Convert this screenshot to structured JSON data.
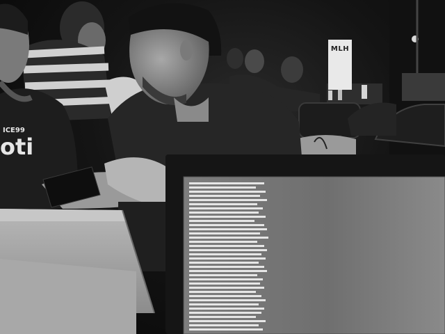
{
  "scene": {
    "description_free": true,
    "background_color": "#0d0d0d",
    "accent_light": "#f2f2f2"
  },
  "banner": {
    "text": "MLH"
  },
  "left_person": {
    "shirt_logo_small": "ICE99",
    "shirt_logo_big": "oti"
  }
}
